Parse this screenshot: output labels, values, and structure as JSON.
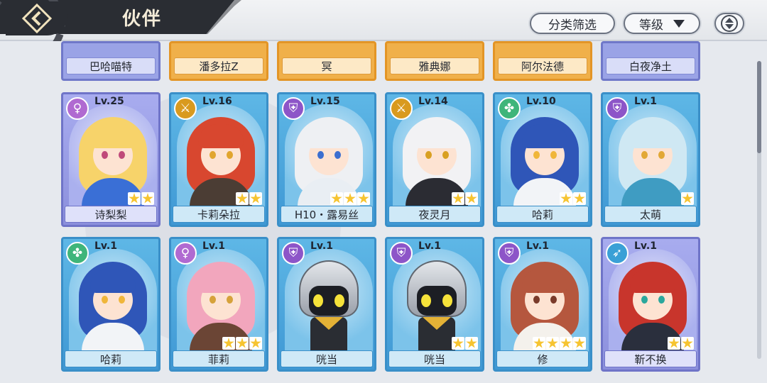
{
  "header": {
    "title": "伙伴",
    "filter_label": "分类筛选",
    "sort_label": "等级"
  },
  "partial_row": [
    {
      "name": "巴哈喵特",
      "frame": "purple"
    },
    {
      "name": "潘多拉Z",
      "frame": "gold"
    },
    {
      "name": "冥",
      "frame": "gold"
    },
    {
      "name": "雅典娜",
      "frame": "gold"
    },
    {
      "name": "阿尔法德",
      "frame": "gold"
    },
    {
      "name": "白夜净土",
      "frame": "purple"
    }
  ],
  "cards": [
    {
      "name": "诗梨梨",
      "level": "Lv.25",
      "stars": 2,
      "frame": "purple",
      "type_icon": "venus-icon",
      "badge_color": "#b06ad1",
      "hair": "#f7d36a",
      "eye": "#c04a7a",
      "body": "#3a6fd6"
    },
    {
      "name": "卡莉朵拉",
      "level": "Lv.16",
      "stars": 2,
      "frame": "blue",
      "type_icon": "dagger-icon",
      "badge_color": "#d99a1e",
      "hair": "#d8472f",
      "eye": "#e1a52e",
      "body": "#4b3d34"
    },
    {
      "name": "H10・露易丝",
      "level": "Lv.15",
      "stars": 3,
      "frame": "blue",
      "type_icon": "shield-icon",
      "badge_color": "#8d55c8",
      "hair": "#eef0f3",
      "eye": "#3c6fd0",
      "body": "#e9eef3"
    },
    {
      "name": "夜灵月",
      "level": "Lv.14",
      "stars": 2,
      "frame": "blue",
      "type_icon": "dagger-icon",
      "badge_color": "#d99a1e",
      "hair": "#f2f2f4",
      "eye": "#d9a022",
      "body": "#2b2c33"
    },
    {
      "name": "哈莉",
      "level": "Lv.10",
      "stars": 2,
      "frame": "blue",
      "type_icon": "clover-icon",
      "badge_color": "#3fb57a",
      "hair": "#2f56b8",
      "eye": "#f0b63a",
      "body": "#f2f4f7"
    },
    {
      "name": "太萌",
      "level": "Lv.1",
      "stars": 1,
      "frame": "blue",
      "type_icon": "shield-icon",
      "badge_color": "#8d55c8",
      "hair": "#cfe8f3",
      "eye": "#e2a835",
      "body": "#3f9cc2"
    },
    {
      "name": "哈莉",
      "level": "Lv.1",
      "stars": 0,
      "frame": "blue",
      "type_icon": "clover-icon",
      "badge_color": "#3fb57a",
      "hair": "#2f56b8",
      "eye": "#f0b63a",
      "body": "#f2f4f7"
    },
    {
      "name": "菲莉",
      "level": "Lv.1",
      "stars": 3,
      "frame": "blue",
      "type_icon": "venus-icon",
      "badge_color": "#b06ad1",
      "hair": "#f2a6bd",
      "eye": "#d6a23a",
      "body": "#6b4535"
    },
    {
      "name": "咣当",
      "level": "Lv.1",
      "stars": 0,
      "frame": "blue",
      "type_icon": "shield-icon",
      "badge_color": "#8d55c8",
      "robot": true
    },
    {
      "name": "咣当",
      "level": "Lv.1",
      "stars": 2,
      "frame": "blue",
      "type_icon": "shield-icon",
      "badge_color": "#8d55c8",
      "robot": true
    },
    {
      "name": "修",
      "level": "Lv.1",
      "stars": 4,
      "frame": "blue",
      "type_icon": "shield-icon",
      "badge_color": "#8d55c8",
      "hair": "#b5573e",
      "eye": "#7a3b2a",
      "body": "#f4f1ec"
    },
    {
      "name": "靳不换",
      "level": "Lv.1",
      "stars": 2,
      "frame": "purple",
      "type_icon": "bow-icon",
      "badge_color": "#3aa0d6",
      "hair": "#c8352c",
      "eye": "#2ba79c",
      "body": "#2a2f3d"
    }
  ]
}
